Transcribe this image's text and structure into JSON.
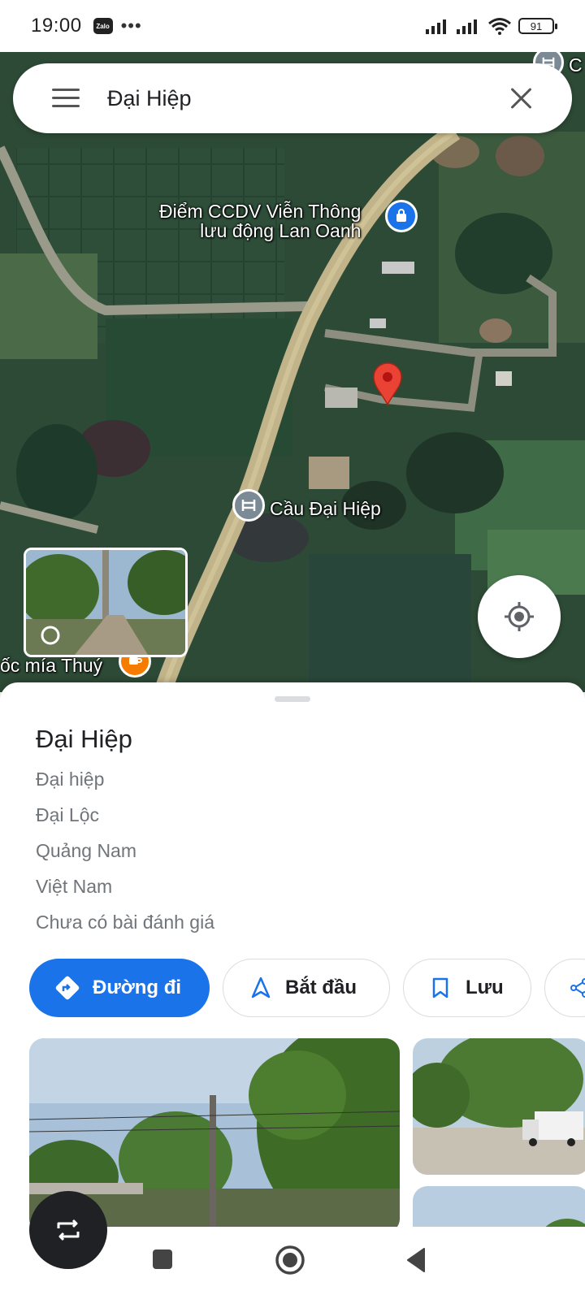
{
  "status_bar": {
    "time": "19:00",
    "app_badge": "Zalo",
    "overflow": "•••",
    "battery": "91"
  },
  "search": {
    "query": "Đại Hiệp"
  },
  "map": {
    "labels": {
      "poi_1_line1": "Điểm CCDV Viễn Thông",
      "poi_1_line2": "lưu động Lan Oanh",
      "poi_2": "Cầu Đại Hiệp",
      "poi_3": "ốc mía Thuý",
      "poi_top_right": "C"
    }
  },
  "place": {
    "title": "Đại Hiệp",
    "address_lines": [
      "Đại hiệp",
      "Đại Lộc",
      "Quảng Nam",
      "Việt Nam"
    ],
    "reviews": "Chưa có bài đánh giá"
  },
  "actions": {
    "directions": "Đường đi",
    "start": "Bắt đầu",
    "save": "Lưu"
  },
  "colors": {
    "primary": "#1a73e8",
    "pin": "#ea4335",
    "poi_shop": "#1a73e8",
    "poi_cafe": "#f57c00",
    "poi_bridge": "#7b8a95"
  },
  "icons": {
    "menu": "menu-icon",
    "close": "close-icon",
    "locate": "my-location-icon",
    "directions": "directions-icon",
    "start": "navigation-arrow-icon",
    "save": "bookmark-icon",
    "share": "share-icon"
  }
}
